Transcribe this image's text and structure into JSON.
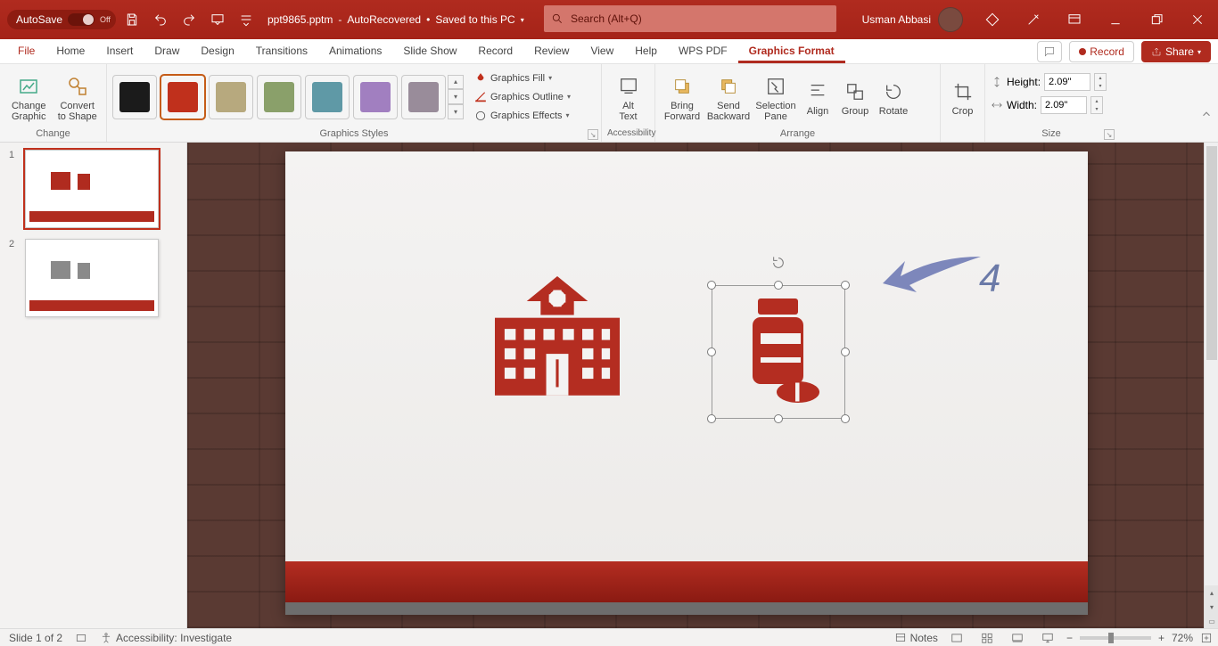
{
  "titlebar": {
    "autosave_label": "AutoSave",
    "autosave_state": "Off",
    "doc_name": "ppt9865.pptm",
    "doc_sep": " - ",
    "doc_state": "AutoRecovered",
    "doc_save": "Saved to this PC",
    "search_placeholder": "Search (Alt+Q)",
    "user_name": "Usman Abbasi"
  },
  "tabs": {
    "file": "File",
    "home": "Home",
    "insert": "Insert",
    "draw": "Draw",
    "design": "Design",
    "transitions": "Transitions",
    "animations": "Animations",
    "slideshow": "Slide Show",
    "record": "Record",
    "review": "Review",
    "view": "View",
    "help": "Help",
    "wps": "WPS PDF",
    "graphics_format": "Graphics Format",
    "record_btn": "Record",
    "share_btn": "Share"
  },
  "ribbon": {
    "change": {
      "label": "Change",
      "change_graphic": "Change\nGraphic",
      "convert": "Convert\nto Shape"
    },
    "styles": {
      "label": "Graphics Styles",
      "colors": [
        "#1b1b1b",
        "#c0301c",
        "#b7a97e",
        "#8aa06a",
        "#5f99a6",
        "#a17fc0",
        "#998c9a"
      ],
      "fill": "Graphics Fill",
      "outline": "Graphics Outline",
      "effects": "Graphics Effects"
    },
    "accessibility": {
      "label": "Accessibility",
      "alt_text": "Alt\nText"
    },
    "arrange": {
      "label": "Arrange",
      "bring_forward": "Bring\nForward",
      "send_backward": "Send\nBackward",
      "selection_pane": "Selection\nPane",
      "align": "Align",
      "group": "Group",
      "rotate": "Rotate"
    },
    "crop": {
      "crop": "Crop"
    },
    "size": {
      "label": "Size",
      "height_label": "Height:",
      "height_value": "2.09\"",
      "width_label": "Width:",
      "width_value": "2.09\""
    }
  },
  "thumbs": {
    "n1": "1",
    "n2": "2"
  },
  "annotation_number": "4",
  "status": {
    "slide_info": "Slide 1 of 2",
    "accessibility": "Accessibility: Investigate",
    "notes": "Notes",
    "zoom_pct": "72%"
  }
}
